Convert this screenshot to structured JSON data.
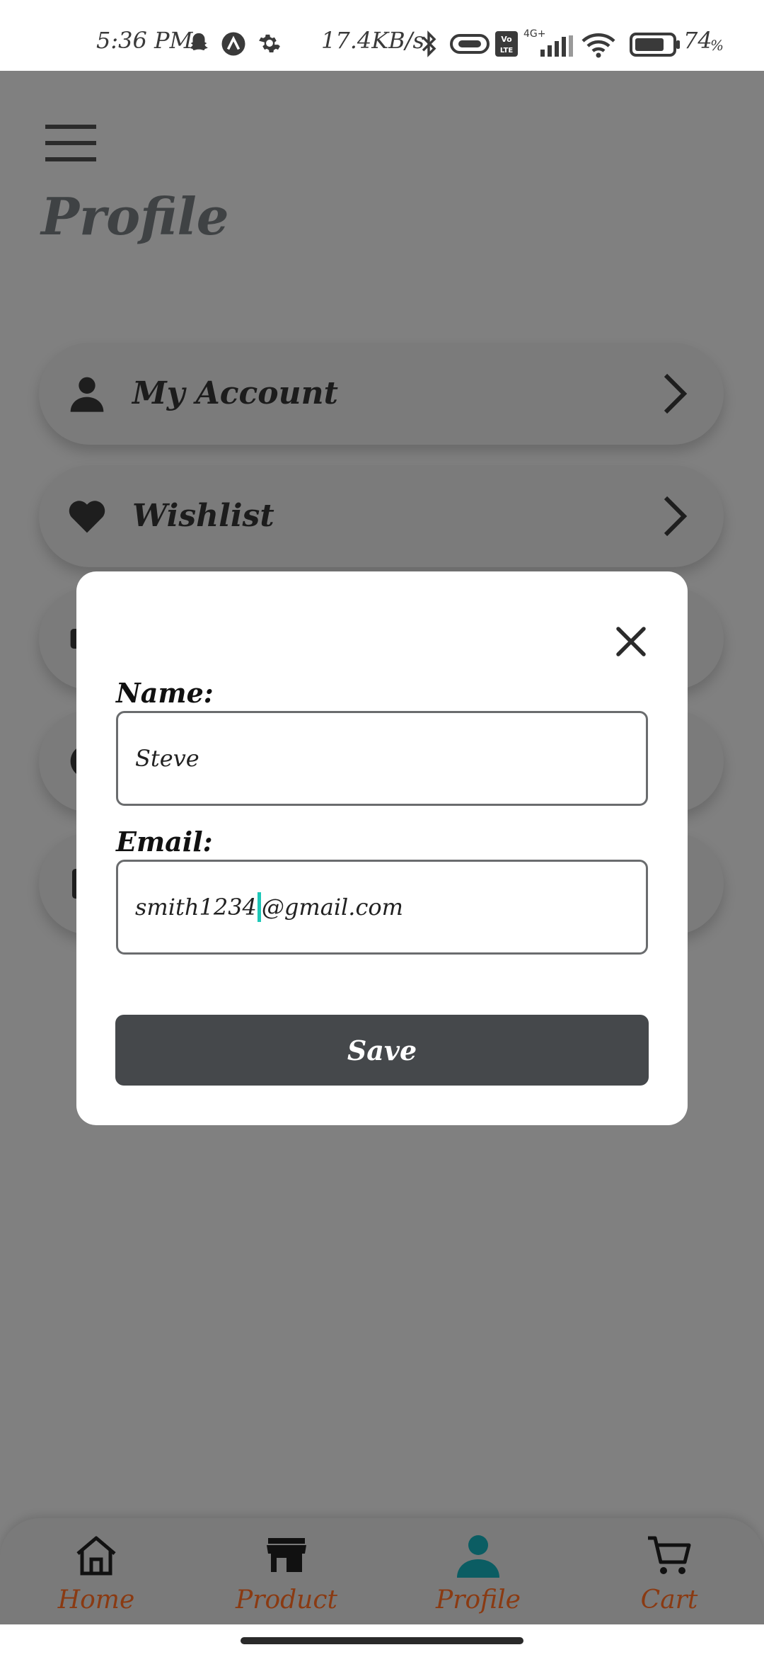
{
  "status_bar": {
    "time": "5:36 PM",
    "speed": "17.4KB/s",
    "network": "4G+",
    "volte": "Vo LTE",
    "battery": "74",
    "battery_unit": "%"
  },
  "header": {
    "title": "Profile"
  },
  "menu": {
    "items": [
      {
        "label": "My Account",
        "icon": "person-icon"
      },
      {
        "label": "Wishlist",
        "icon": "heart-icon"
      }
    ]
  },
  "modal": {
    "name_label": "Name:",
    "name_value": "Steve",
    "email_label": "Email:",
    "email_value_before_caret": "smith1234",
    "email_value_after_caret": "@gmail.com",
    "save_label": "Save"
  },
  "bottom_nav": {
    "items": [
      {
        "label": "Home",
        "icon": "home-icon"
      },
      {
        "label": "Product",
        "icon": "store-icon"
      },
      {
        "label": "Profile",
        "icon": "person-icon",
        "active": true
      },
      {
        "label": "Cart",
        "icon": "cart-icon"
      }
    ],
    "active_color": "#0b5d63",
    "label_color": "#8a3a12"
  }
}
